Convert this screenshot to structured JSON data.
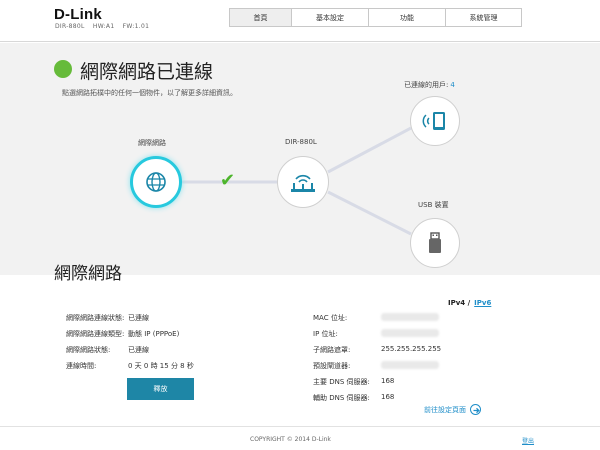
{
  "header": {
    "logo": "D-Link",
    "model": "DIR-880L",
    "hw": "HW:A1",
    "fw": "FW:1.01",
    "tabs": [
      {
        "label": "首頁"
      },
      {
        "label": "基本設定"
      },
      {
        "label": "功能"
      },
      {
        "label": "系統管理"
      }
    ]
  },
  "status": {
    "title": "網際網路已連線",
    "subtitle": "點選網路拓樸中的任何一個物件，以了解更多詳細資訊。",
    "color": "#66bb3a"
  },
  "topology": {
    "internet_label": "網際網路",
    "router_label": "DIR-880L",
    "clients_label": "已連線的用戶:",
    "clients_count": "4",
    "usb_label": "USB 裝置",
    "icons": {
      "internet": "globe-icon",
      "router": "router-icon",
      "clients": "tablet-icon",
      "usb": "usb-drive-icon",
      "link": "check-icon"
    }
  },
  "section": {
    "title": "網際網路",
    "ipv4": "IPv4 /",
    "ipv6": "IPv6"
  },
  "info_left": [
    {
      "key": "網際網路連線狀態:",
      "value": "已連線"
    },
    {
      "key": "網際網路連線類型:",
      "value": "動態 IP (PPPoE)"
    },
    {
      "key": "網際網路狀態:",
      "value": "已連線"
    },
    {
      "key": "連線時間:",
      "value": "0 天 0 時 15 分 8 秒"
    }
  ],
  "info_right": [
    {
      "key": "MAC 位址:",
      "value": ""
    },
    {
      "key": "IP 位址:",
      "value": ""
    },
    {
      "key": "子網路遮罩:",
      "value": "255.255.255.255"
    },
    {
      "key": "預設閘道器:",
      "value": ""
    },
    {
      "key": "主要 DNS 伺服器:",
      "value": "168"
    },
    {
      "key": "輔助 DNS 伺服器:",
      "value": "168"
    }
  ],
  "actions": {
    "release": "釋放",
    "go_settings": "前往設定頁面"
  },
  "footer": {
    "copyright": "COPYRIGHT © 2014 D-Link",
    "logout": "登出"
  },
  "colors": {
    "accent": "#1f8ec9",
    "button": "#1e86a6",
    "highlight": "#27c9de",
    "connected": "#4db52c"
  }
}
